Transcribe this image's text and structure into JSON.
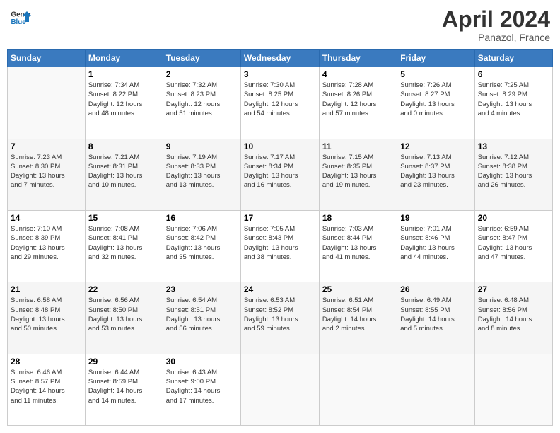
{
  "header": {
    "logo_line1": "General",
    "logo_line2": "Blue",
    "month": "April 2024",
    "location": "Panazol, France"
  },
  "columns": [
    "Sunday",
    "Monday",
    "Tuesday",
    "Wednesday",
    "Thursday",
    "Friday",
    "Saturday"
  ],
  "weeks": [
    [
      {
        "num": "",
        "info": ""
      },
      {
        "num": "1",
        "info": "Sunrise: 7:34 AM\nSunset: 8:22 PM\nDaylight: 12 hours\nand 48 minutes."
      },
      {
        "num": "2",
        "info": "Sunrise: 7:32 AM\nSunset: 8:23 PM\nDaylight: 12 hours\nand 51 minutes."
      },
      {
        "num": "3",
        "info": "Sunrise: 7:30 AM\nSunset: 8:25 PM\nDaylight: 12 hours\nand 54 minutes."
      },
      {
        "num": "4",
        "info": "Sunrise: 7:28 AM\nSunset: 8:26 PM\nDaylight: 12 hours\nand 57 minutes."
      },
      {
        "num": "5",
        "info": "Sunrise: 7:26 AM\nSunset: 8:27 PM\nDaylight: 13 hours\nand 0 minutes."
      },
      {
        "num": "6",
        "info": "Sunrise: 7:25 AM\nSunset: 8:29 PM\nDaylight: 13 hours\nand 4 minutes."
      }
    ],
    [
      {
        "num": "7",
        "info": "Sunrise: 7:23 AM\nSunset: 8:30 PM\nDaylight: 13 hours\nand 7 minutes."
      },
      {
        "num": "8",
        "info": "Sunrise: 7:21 AM\nSunset: 8:31 PM\nDaylight: 13 hours\nand 10 minutes."
      },
      {
        "num": "9",
        "info": "Sunrise: 7:19 AM\nSunset: 8:33 PM\nDaylight: 13 hours\nand 13 minutes."
      },
      {
        "num": "10",
        "info": "Sunrise: 7:17 AM\nSunset: 8:34 PM\nDaylight: 13 hours\nand 16 minutes."
      },
      {
        "num": "11",
        "info": "Sunrise: 7:15 AM\nSunset: 8:35 PM\nDaylight: 13 hours\nand 19 minutes."
      },
      {
        "num": "12",
        "info": "Sunrise: 7:13 AM\nSunset: 8:37 PM\nDaylight: 13 hours\nand 23 minutes."
      },
      {
        "num": "13",
        "info": "Sunrise: 7:12 AM\nSunset: 8:38 PM\nDaylight: 13 hours\nand 26 minutes."
      }
    ],
    [
      {
        "num": "14",
        "info": "Sunrise: 7:10 AM\nSunset: 8:39 PM\nDaylight: 13 hours\nand 29 minutes."
      },
      {
        "num": "15",
        "info": "Sunrise: 7:08 AM\nSunset: 8:41 PM\nDaylight: 13 hours\nand 32 minutes."
      },
      {
        "num": "16",
        "info": "Sunrise: 7:06 AM\nSunset: 8:42 PM\nDaylight: 13 hours\nand 35 minutes."
      },
      {
        "num": "17",
        "info": "Sunrise: 7:05 AM\nSunset: 8:43 PM\nDaylight: 13 hours\nand 38 minutes."
      },
      {
        "num": "18",
        "info": "Sunrise: 7:03 AM\nSunset: 8:44 PM\nDaylight: 13 hours\nand 41 minutes."
      },
      {
        "num": "19",
        "info": "Sunrise: 7:01 AM\nSunset: 8:46 PM\nDaylight: 13 hours\nand 44 minutes."
      },
      {
        "num": "20",
        "info": "Sunrise: 6:59 AM\nSunset: 8:47 PM\nDaylight: 13 hours\nand 47 minutes."
      }
    ],
    [
      {
        "num": "21",
        "info": "Sunrise: 6:58 AM\nSunset: 8:48 PM\nDaylight: 13 hours\nand 50 minutes."
      },
      {
        "num": "22",
        "info": "Sunrise: 6:56 AM\nSunset: 8:50 PM\nDaylight: 13 hours\nand 53 minutes."
      },
      {
        "num": "23",
        "info": "Sunrise: 6:54 AM\nSunset: 8:51 PM\nDaylight: 13 hours\nand 56 minutes."
      },
      {
        "num": "24",
        "info": "Sunrise: 6:53 AM\nSunset: 8:52 PM\nDaylight: 13 hours\nand 59 minutes."
      },
      {
        "num": "25",
        "info": "Sunrise: 6:51 AM\nSunset: 8:54 PM\nDaylight: 14 hours\nand 2 minutes."
      },
      {
        "num": "26",
        "info": "Sunrise: 6:49 AM\nSunset: 8:55 PM\nDaylight: 14 hours\nand 5 minutes."
      },
      {
        "num": "27",
        "info": "Sunrise: 6:48 AM\nSunset: 8:56 PM\nDaylight: 14 hours\nand 8 minutes."
      }
    ],
    [
      {
        "num": "28",
        "info": "Sunrise: 6:46 AM\nSunset: 8:57 PM\nDaylight: 14 hours\nand 11 minutes."
      },
      {
        "num": "29",
        "info": "Sunrise: 6:44 AM\nSunset: 8:59 PM\nDaylight: 14 hours\nand 14 minutes."
      },
      {
        "num": "30",
        "info": "Sunrise: 6:43 AM\nSunset: 9:00 PM\nDaylight: 14 hours\nand 17 minutes."
      },
      {
        "num": "",
        "info": ""
      },
      {
        "num": "",
        "info": ""
      },
      {
        "num": "",
        "info": ""
      },
      {
        "num": "",
        "info": ""
      }
    ]
  ]
}
